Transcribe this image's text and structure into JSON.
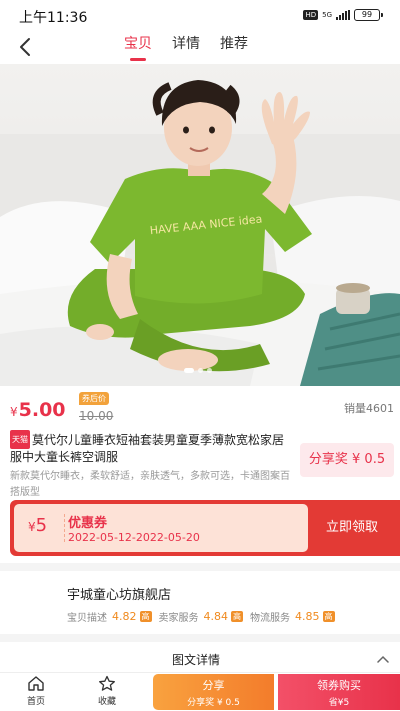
{
  "status_bar": {
    "time": "上午11:36",
    "hd": "HD",
    "network": "5G",
    "battery": "99"
  },
  "nav": {
    "tabs": [
      {
        "label": "宝贝",
        "active": true
      },
      {
        "label": "详情"
      },
      {
        "label": "推荐"
      }
    ]
  },
  "product": {
    "price_symbol": "¥",
    "price": "5.00",
    "coupon_price_tag": "券后价",
    "original_price": "10.00",
    "sales": "销量4601",
    "platform_tag": "天猫",
    "title": "莫代尔儿童睡衣短袖套装男童夏季薄款宽松家居服中大童长裤空调服",
    "description": "新款莫代尔睡衣，柔软舒适，亲肤透气，多款可选，卡通图案百搭版型",
    "share_reward": "分享奖 ¥ 0.5",
    "image_text": "HAVE AAA NICE idea"
  },
  "coupon": {
    "symbol": "¥",
    "amount": "5",
    "name": "优惠券",
    "date_range": "2022-05-12-2022-05-20",
    "claim_button": "立即领取"
  },
  "shop": {
    "name": "宇城童心坊旗舰店",
    "ratings": [
      {
        "label": "宝贝描述",
        "value": "4.82",
        "badge": "高"
      },
      {
        "label": "卖家服务",
        "value": "4.84",
        "badge": "高"
      },
      {
        "label": "物流服务",
        "value": "4.85",
        "badge": "高"
      }
    ]
  },
  "detail_section": {
    "title": "图文详情"
  },
  "bottom_bar": {
    "home": "首页",
    "favorite": "收藏",
    "share_label": "分享",
    "share_sub": "分享奖 ¥ 0.5",
    "buy_label": "领券购买",
    "buy_sub": "省¥5"
  },
  "colors": {
    "accent": "#e8324a",
    "orange": "#f37c2b",
    "shirt_green": "#7cb82f"
  },
  "icons": [
    "back-arrow-icon",
    "home-icon",
    "star-icon",
    "chevron-up-icon"
  ]
}
